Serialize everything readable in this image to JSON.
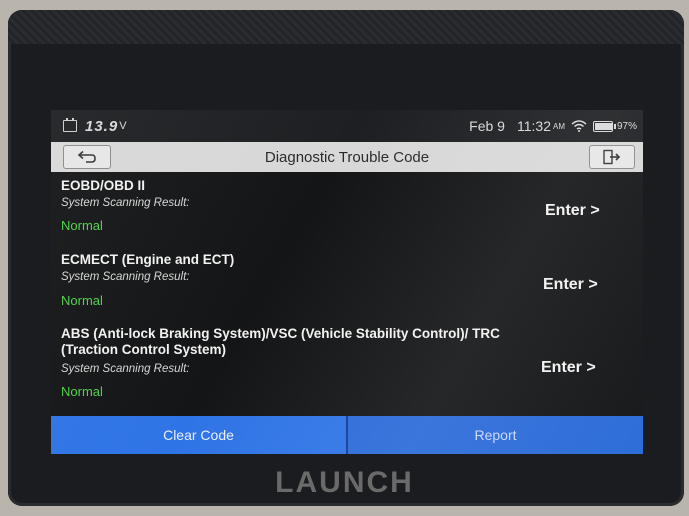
{
  "status_bar": {
    "voltage": "13.9",
    "voltage_unit": "V",
    "date": "Feb 9",
    "time": "11:32",
    "ampm": "AM",
    "battery_percent": "97%",
    "battery_level": 0.97
  },
  "header": {
    "title": "Diagnostic Trouble Code",
    "back_icon": "back-arrow-icon",
    "exit_icon": "exit-icon"
  },
  "systems": [
    {
      "name": "EOBD/OBD II",
      "scan_label": "System Scanning Result:",
      "result": "Normal",
      "enter_label": "Enter >"
    },
    {
      "name": "ECMECT (Engine and ECT)",
      "scan_label": "System Scanning Result:",
      "result": "Normal",
      "enter_label": "Enter >"
    },
    {
      "name": "ABS (Anti-lock Braking System)/VSC (Vehicle Stability Control)/ TRC (Traction Control System)",
      "scan_label": "System Scanning Result:",
      "result": "Normal",
      "enter_label": "Enter >"
    }
  ],
  "footer": {
    "clear_code_label": "Clear Code",
    "report_label": "Report"
  },
  "device": {
    "brand": "LAUNCH"
  },
  "colors": {
    "accent_blue": "#2f74e6",
    "normal_green": "#4fd14a",
    "screen_bg": "#141516"
  }
}
